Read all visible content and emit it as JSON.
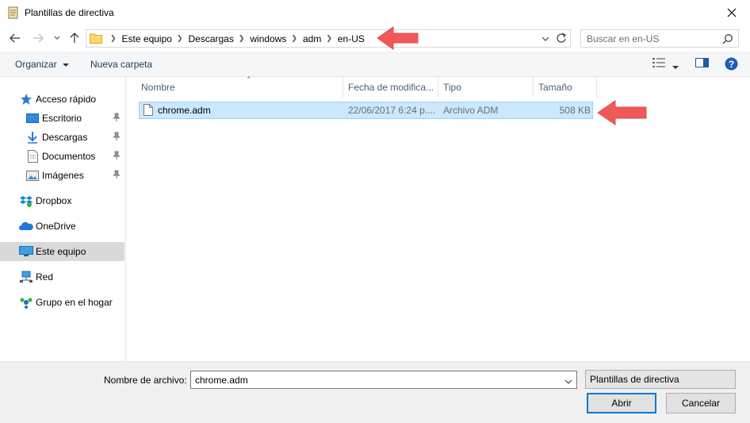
{
  "window": {
    "title": "Plantillas de directiva"
  },
  "address_bar": {
    "breadcrumbs": [
      "Este equipo",
      "Descargas",
      "windows",
      "adm",
      "en-US"
    ]
  },
  "search": {
    "placeholder": "Buscar en en-US"
  },
  "toolbar": {
    "organize_label": "Organizar",
    "new_folder_label": "Nueva carpeta"
  },
  "sidebar": {
    "items": [
      {
        "label": "Acceso rápido",
        "icon": "star-icon"
      },
      {
        "label": "Escritorio",
        "icon": "desktop-icon",
        "pinned": true
      },
      {
        "label": "Descargas",
        "icon": "download-icon",
        "pinned": true
      },
      {
        "label": "Documentos",
        "icon": "document-icon",
        "pinned": true
      },
      {
        "label": "Imágenes",
        "icon": "pictures-icon",
        "pinned": true
      },
      {
        "label": "Dropbox",
        "icon": "dropbox-icon"
      },
      {
        "label": "OneDrive",
        "icon": "onedrive-icon"
      },
      {
        "label": "Este equipo",
        "icon": "computer-icon",
        "selected": true
      },
      {
        "label": "Red",
        "icon": "network-icon"
      },
      {
        "label": "Grupo en el hogar",
        "icon": "homegroup-icon"
      }
    ]
  },
  "file_list": {
    "columns": [
      "Nombre",
      "Fecha de modifica...",
      "Tipo",
      "Tamaño"
    ],
    "rows": [
      {
        "name": "chrome.adm",
        "modified": "22/06/2017 6:24 p....",
        "type": "Archivo ADM",
        "size": "508 KB",
        "selected": true
      }
    ]
  },
  "footer": {
    "filename_label": "Nombre de archivo:",
    "filename_value": "chrome.adm",
    "filetype_value": "Plantillas de directiva",
    "open_label": "Abrir",
    "cancel_label": "Cancelar"
  },
  "colors": {
    "selection_bg": "#cce8ff",
    "selection_border": "#99d1ff",
    "annotation_arrow": "#f0595a",
    "primary_border": "#0078d7"
  }
}
